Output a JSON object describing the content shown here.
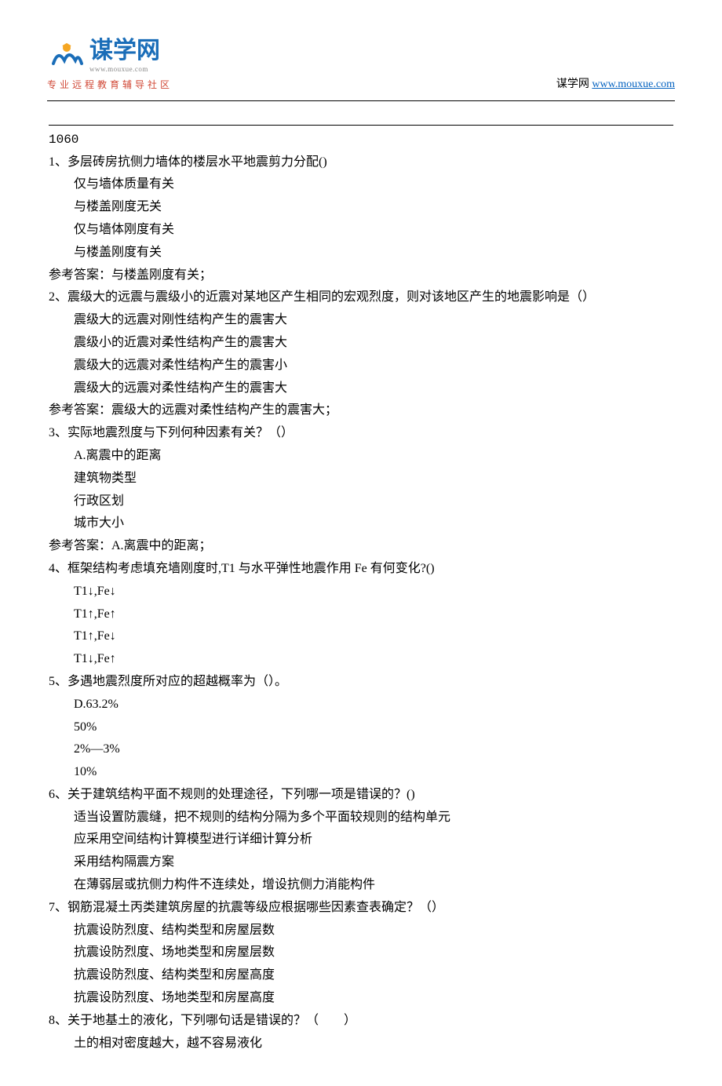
{
  "header": {
    "logo_cn": "谋学网",
    "logo_url": "www.mouxue.com",
    "logo_sub": "专业远程教育辅导社区",
    "site_label": "谋学网",
    "site_link": "www.mouxue.com"
  },
  "code": "1060",
  "questions": [
    {
      "q": "1、多层砖房抗侧力墙体的楼层水平地震剪力分配()",
      "options": [
        "仅与墙体质量有关",
        "与楼盖刚度无关",
        "仅与墙体刚度有关",
        "与楼盖刚度有关"
      ],
      "answer": "参考答案：与楼盖刚度有关；"
    },
    {
      "q": "2、震级大的远震与震级小的近震对某地区产生相同的宏观烈度，则对该地区产生的地震影响是（）",
      "options": [
        "震级大的远震对刚性结构产生的震害大",
        "震级小的近震对柔性结构产生的震害大",
        "震级大的远震对柔性结构产生的震害小",
        "震级大的远震对柔性结构产生的震害大"
      ],
      "answer": "参考答案：震级大的远震对柔性结构产生的震害大；"
    },
    {
      "q": "3、实际地震烈度与下列何种因素有关？（）",
      "options": [
        "A.离震中的距离",
        "建筑物类型",
        "行政区划",
        "城市大小"
      ],
      "answer": "参考答案：A.离震中的距离；"
    },
    {
      "q": "4、框架结构考虑填充墙刚度时,T1 与水平弹性地震作用 Fe 有何变化?()",
      "options": [
        "T1↓,Fe↓",
        "T1↑,Fe↑",
        "T1↑,Fe↓",
        "T1↓,Fe↑"
      ],
      "answer": ""
    },
    {
      "q": "5、多遇地震烈度所对应的超越概率为（）。",
      "options": [
        "D.63.2%",
        "50%",
        "2%—3%",
        "10%"
      ],
      "answer": ""
    },
    {
      "q": "6、关于建筑结构平面不规则的处理途径，下列哪一项是错误的？()",
      "options": [
        "适当设置防震缝，把不规则的结构分隔为多个平面较规则的结构单元",
        "应采用空间结构计算模型进行详细计算分析",
        "采用结构隔震方案",
        "在薄弱层或抗侧力构件不连续处，增设抗侧力消能构件"
      ],
      "answer": ""
    },
    {
      "q": "7、钢筋混凝土丙类建筑房屋的抗震等级应根据哪些因素查表确定？（）",
      "options": [
        "抗震设防烈度、结构类型和房屋层数",
        "抗震设防烈度、场地类型和房屋层数",
        "抗震设防烈度、结构类型和房屋高度",
        "抗震设防烈度、场地类型和房屋高度"
      ],
      "answer": ""
    },
    {
      "q": "8、关于地基土的液化，下列哪句话是错误的？（　　）",
      "options": [
        "土的相对密度越大，越不容易液化"
      ],
      "answer": ""
    }
  ]
}
